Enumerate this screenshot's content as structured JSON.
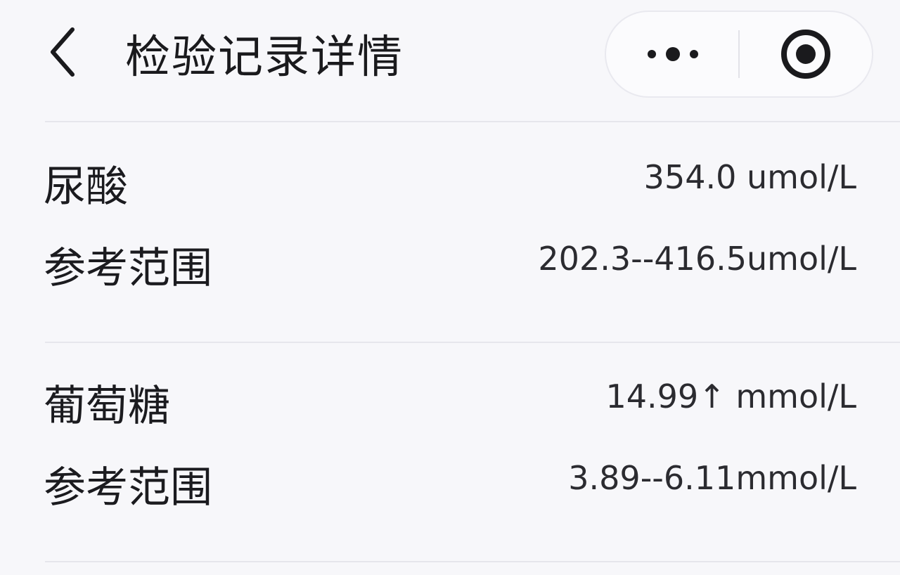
{
  "header": {
    "back_icon": "chevron-left-icon",
    "title": "检验记录详情",
    "capsule": {
      "more_icon": "more-dots-icon",
      "close_icon": "target-circle-icon"
    }
  },
  "results": [
    {
      "name": "尿酸",
      "value": "354.0 umol/L",
      "range_label": "参考范围",
      "range_value": "202.3--416.5umol/L"
    },
    {
      "name": "葡萄糖",
      "value": "14.99↑ mmol/L",
      "range_label": "参考范围",
      "range_value": "3.89--6.11mmol/L"
    }
  ],
  "colors": {
    "background": "#f7f7fa",
    "text": "#1b1b1f",
    "divider": "#e6e6ec"
  }
}
